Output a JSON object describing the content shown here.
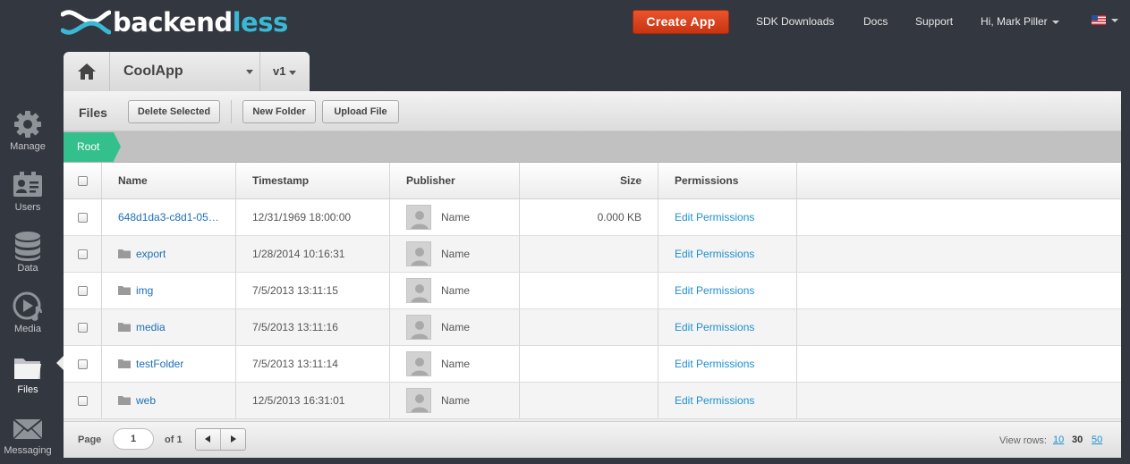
{
  "header": {
    "logo_text_main": "backend",
    "logo_text_accent": "less",
    "create_app_label": "Create App",
    "links": {
      "sdk": "SDK Downloads",
      "docs": "Docs",
      "support": "Support",
      "user": "Hi, Mark Piller"
    },
    "flag_icon": "us-flag-icon"
  },
  "nav": {
    "items": [
      {
        "label": "Manage",
        "icon": "gear-icon"
      },
      {
        "label": "Users",
        "icon": "user-card-icon"
      },
      {
        "label": "Data",
        "icon": "database-icon"
      },
      {
        "label": "Media",
        "icon": "media-play-icon"
      },
      {
        "label": "Files",
        "icon": "folder-icon"
      },
      {
        "label": "Messaging",
        "icon": "envelope-icon"
      }
    ],
    "active": "Files"
  },
  "app_tabs": {
    "app_name": "CoolApp",
    "version": "v1"
  },
  "toolbar": {
    "title": "Files",
    "delete_label": "Delete Selected",
    "new_folder_label": "New Folder",
    "upload_label": "Upload File"
  },
  "breadcrumb": {
    "root": "Root"
  },
  "table": {
    "columns": {
      "name": "Name",
      "timestamp": "Timestamp",
      "publisher": "Publisher",
      "size": "Size",
      "permissions": "Permissions"
    },
    "rows": [
      {
        "name": "648d1da3-c8d1-05…",
        "is_folder": false,
        "timestamp": "12/31/1969 18:00:00",
        "publisher": "Name",
        "size": "0.000 KB",
        "permissions": "Edit Permissions"
      },
      {
        "name": "export",
        "is_folder": true,
        "timestamp": "1/28/2014 10:16:31",
        "publisher": "Name",
        "size": "",
        "permissions": "Edit Permissions"
      },
      {
        "name": "img",
        "is_folder": true,
        "timestamp": "7/5/2013 13:11:15",
        "publisher": "Name",
        "size": "",
        "permissions": "Edit Permissions"
      },
      {
        "name": "media",
        "is_folder": true,
        "timestamp": "7/5/2013 13:11:16",
        "publisher": "Name",
        "size": "",
        "permissions": "Edit Permissions"
      },
      {
        "name": "testFolder",
        "is_folder": true,
        "timestamp": "7/5/2013 13:11:14",
        "publisher": "Name",
        "size": "",
        "permissions": "Edit Permissions"
      },
      {
        "name": "web",
        "is_folder": true,
        "timestamp": "12/5/2013 16:31:01",
        "publisher": "Name",
        "size": "",
        "permissions": "Edit Permissions"
      }
    ]
  },
  "footer": {
    "page_label": "Page",
    "page_value": "1",
    "of_label": "of 1",
    "view_rows_label": "View rows:",
    "view_rows_options": [
      "10",
      "30",
      "50"
    ],
    "view_rows_selected": "30"
  },
  "colors": {
    "accent": "#34c08d",
    "create_button": "#d8401c",
    "link": "#1e90cf",
    "sidebar_bg": "#33373f"
  }
}
